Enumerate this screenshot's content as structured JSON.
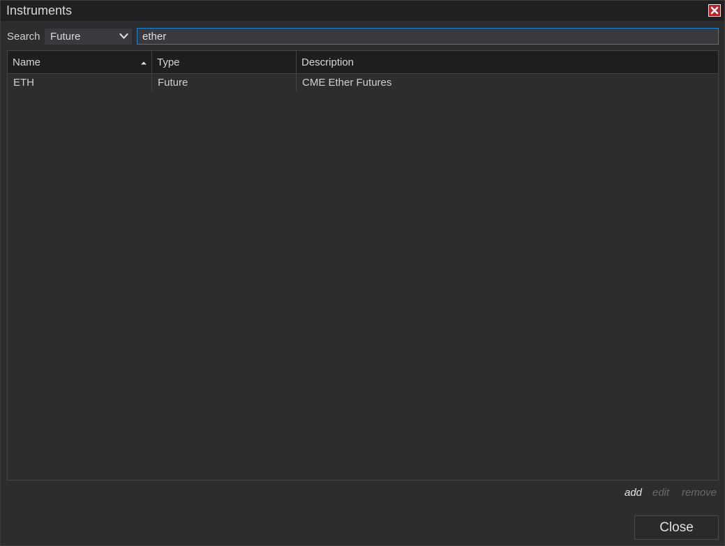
{
  "window": {
    "title": "Instruments"
  },
  "search": {
    "label": "Search",
    "type_selected": "Future",
    "query": "ether"
  },
  "table": {
    "columns": [
      "Name",
      "Type",
      "Description"
    ],
    "sort_column": "Name",
    "sort_direction": "ascending",
    "rows": [
      {
        "name": "ETH",
        "type": "Future",
        "description": "CME Ether Futures"
      }
    ]
  },
  "actions": {
    "add": "add",
    "edit": "edit",
    "remove": "remove"
  },
  "footer": {
    "close_label": "Close"
  },
  "colors": {
    "accent_focus": "#1c7fd0",
    "close_icon_bg": "#b8222a"
  },
  "icons": {
    "window_close": "close-x-icon",
    "dropdown": "chevron-down-icon",
    "sort": "sort-ascending-icon"
  }
}
